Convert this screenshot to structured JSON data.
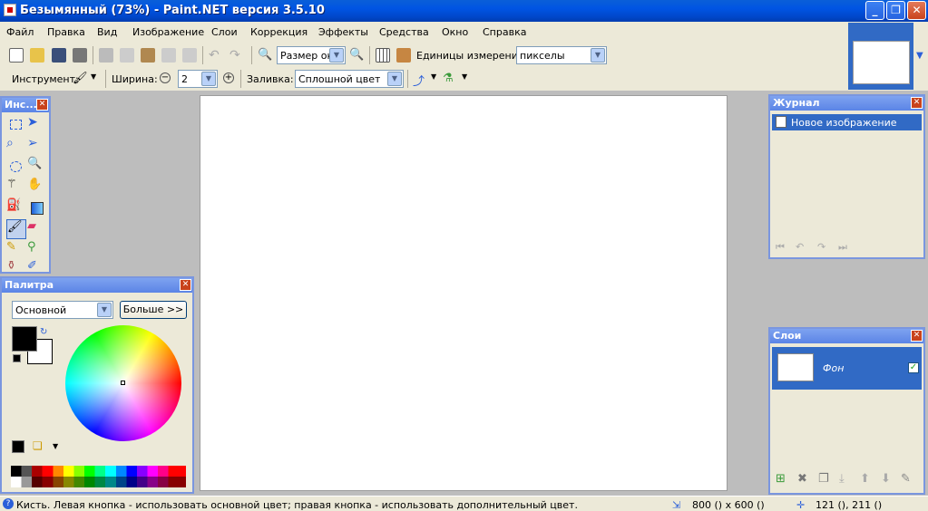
{
  "window": {
    "title": "Безымянный (73%) - Paint.NET версия 3.5.10"
  },
  "menu": [
    "Файл",
    "Правка",
    "Вид",
    "Изображение",
    "Слои",
    "Коррекция",
    "Эффекты",
    "Средства",
    "Окно",
    "Справка"
  ],
  "toolbar1": {
    "zoom_select": "Размер окна",
    "units_label": "Единицы измерения:",
    "units_value": "пикселы"
  },
  "toolbar2": {
    "tool_label": "Инструмент:",
    "width_label": "Ширина:",
    "width_value": "2",
    "fill_label": "Заливка:",
    "fill_value": "Сплошной цвет"
  },
  "tools_window": {
    "title": "Инс..."
  },
  "palette_window": {
    "title": "Палитра",
    "mode": "Основной",
    "more_button": "Больше >>",
    "primary_color": "#000000",
    "secondary_color": "#ffffff"
  },
  "history_window": {
    "title": "Журнал",
    "items": [
      "Новое изображение"
    ]
  },
  "layers_window": {
    "title": "Слои",
    "layers": [
      {
        "name": "Фон",
        "visible": true
      }
    ]
  },
  "status": {
    "message": "Кисть. Левая кнопка - использовать основной цвет; правая кнопка - использовать дополнительный цвет.",
    "image_size": "800 () x 600 ()",
    "cursor_pos": "121 (), 211 ()"
  },
  "colors": {
    "accent": "#316ac5",
    "titlebar": "#0054e3"
  }
}
